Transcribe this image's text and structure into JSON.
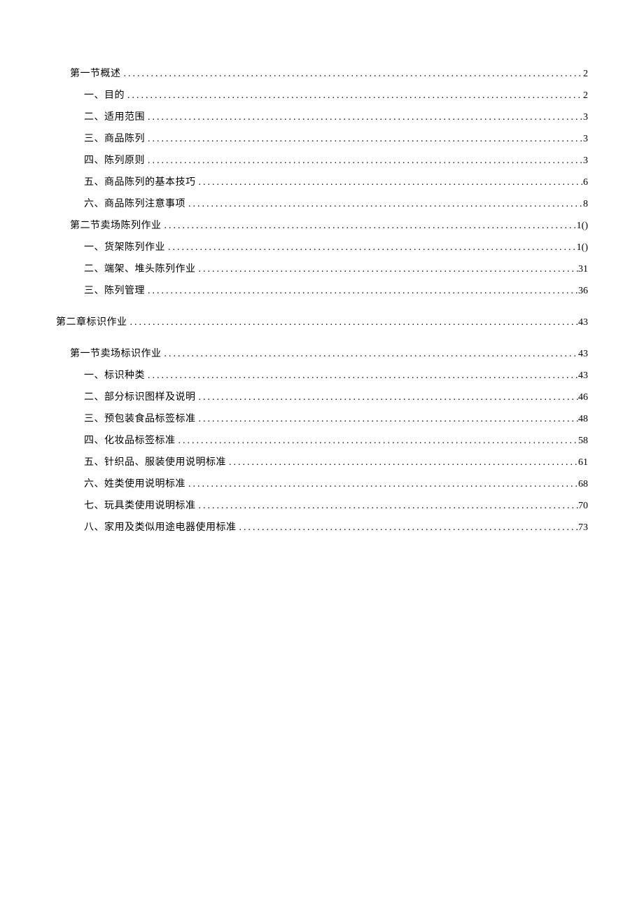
{
  "toc": [
    {
      "level": 1,
      "label": "第一节概述",
      "page": "2"
    },
    {
      "level": 2,
      "label": "一、目的",
      "page": "2"
    },
    {
      "level": 2,
      "label": "二、适用范围",
      "page": "3"
    },
    {
      "level": 2,
      "label": "三、商品陈列",
      "page": "3"
    },
    {
      "level": 2,
      "label": "四、陈列原则",
      "page": "3"
    },
    {
      "level": 2,
      "label": "五、商品陈列的基本技巧",
      "page": "6"
    },
    {
      "level": 2,
      "label": "六、商品陈列注意事项",
      "page": "8"
    },
    {
      "level": 1,
      "label": "第二节卖场陈列作业",
      "page": "1()"
    },
    {
      "level": 2,
      "label": "一、货架陈列作业",
      "page": "1()"
    },
    {
      "level": 2,
      "label": "二、端架、堆头陈列作业",
      "page": "31"
    },
    {
      "level": 2,
      "label": "三、陈列管理",
      "page": "36"
    },
    {
      "level": 0,
      "label": "第二章标识作业",
      "page": "43",
      "gapBefore": true
    },
    {
      "level": 1,
      "label": "第一节卖场标识作业",
      "page": "43",
      "gapBefore": true
    },
    {
      "level": 2,
      "label": "一、标识种类",
      "page": "43"
    },
    {
      "level": 2,
      "label": "二、部分标识图样及说明",
      "page": "46"
    },
    {
      "level": 2,
      "label": "三、预包装食品标签标准",
      "page": "48"
    },
    {
      "level": 2,
      "label": "四、化妆品标签标准",
      "page": "58"
    },
    {
      "level": 2,
      "label": "五、针织品、服装使用说明标准",
      "page": "61"
    },
    {
      "level": 2,
      "label": "六、姓类使用说明标准",
      "page": "68"
    },
    {
      "level": 2,
      "label": "七、玩具类使用说明标准",
      "page": "70"
    },
    {
      "level": 2,
      "label": "八、家用及类似用途电器使用标准",
      "page": "73"
    }
  ]
}
